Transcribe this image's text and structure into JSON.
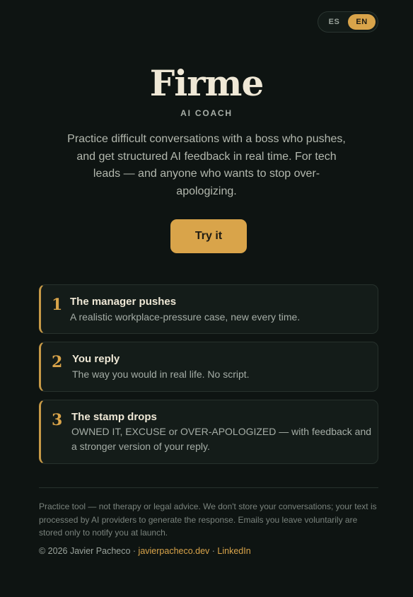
{
  "lang": {
    "es": "ES",
    "en": "EN",
    "active": "EN"
  },
  "hero": {
    "title": "Firme",
    "subtitle": "AI COACH",
    "tagline": "Practice difficult conversations with a boss who pushes, and get structured AI feedback in real time. For tech leads — and anyone who wants to stop over-apologizing.",
    "cta": "Try it"
  },
  "steps": [
    {
      "num": "1",
      "title": "The manager pushes",
      "desc": "A realistic workplace-pressure case, new every time."
    },
    {
      "num": "2",
      "title": "You reply",
      "desc": "The way you would in real life. No script."
    },
    {
      "num": "3",
      "title": "The stamp drops",
      "desc": "OWNED IT, EXCUSE or OVER-APOLOGIZED — with feedback and a stronger version of your reply."
    }
  ],
  "footer": {
    "disclaimer": "Practice tool — not therapy or legal advice. We don't store your conversations; your text is processed by AI providers to generate the response. Emails you leave voluntarily are stored only to notify you at launch.",
    "copyright": "© 2026 Javier Pacheco · ",
    "separator": " · ",
    "site_link": "javierpacheco.dev",
    "linkedin_link": "LinkedIn"
  },
  "colors": {
    "accent": "#d9a44a",
    "background": "#0e1412",
    "card": "#141c19"
  }
}
